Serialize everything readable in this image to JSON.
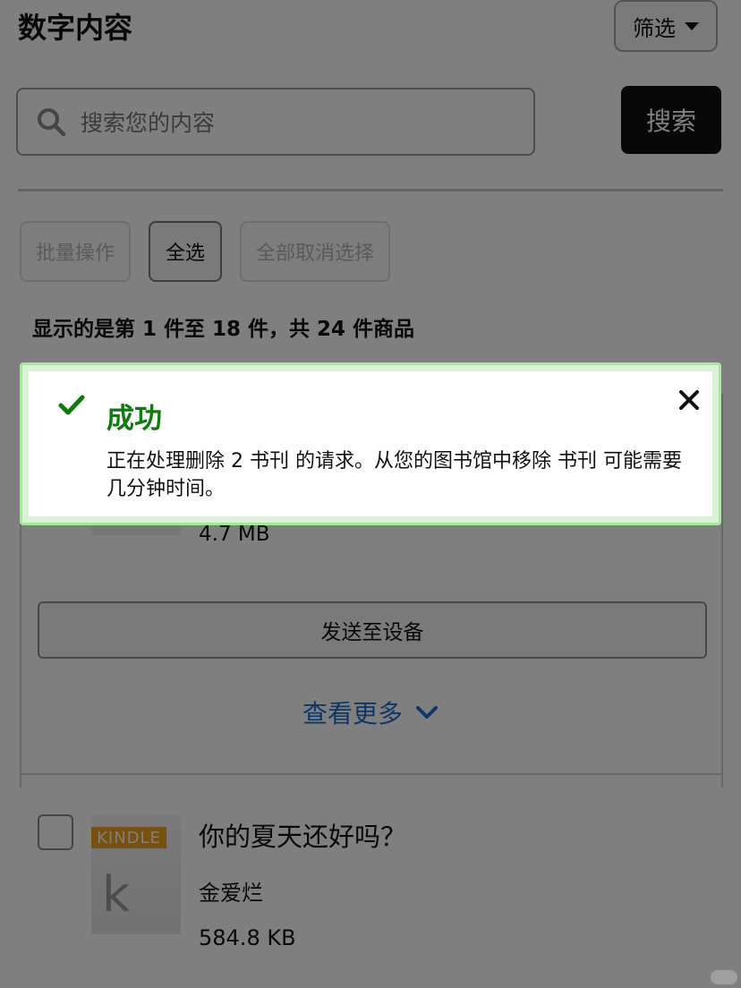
{
  "header": {
    "title": "数字内容",
    "filter_label": "筛选"
  },
  "search": {
    "placeholder": "搜索您的内容",
    "button_label": "搜索"
  },
  "actions": {
    "bulk": "批量操作",
    "select_all": "全选",
    "deselect_all": "全部取消选择"
  },
  "results": {
    "count_text": "显示的是第 1 件至 18 件，共 24 件商品"
  },
  "items": [
    {
      "size": "4.7 MB",
      "send_label": "发送至设备",
      "more_label": "查看更多"
    },
    {
      "tag": "KINDLE",
      "cover_letter": "k",
      "title": "你的夏天还好吗？",
      "author": "金爱烂",
      "size": "584.8 KB"
    }
  ],
  "alert": {
    "title": "成功",
    "message": "正在处理删除 2 书刊 的请求。从您的图书馆中移除 书刊 可能需要几分钟时间。"
  },
  "colors": {
    "success": "#107a10",
    "link": "#1f6cc8",
    "tag": "#f0a020"
  }
}
